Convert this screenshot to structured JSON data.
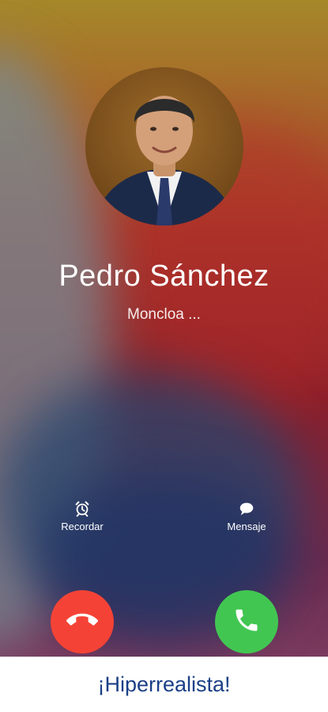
{
  "caller": {
    "name": "Pedro Sánchez",
    "subtitle": "Moncloa ..."
  },
  "actions": {
    "remind_label": "Recordar",
    "message_label": "Mensaje"
  },
  "buttons": {
    "decline_color": "#f44336",
    "accept_color": "#42c652"
  },
  "banner": {
    "text": "¡Hiperrealista!",
    "color": "#1a3f87"
  },
  "icons": [
    "alarm-clock-icon",
    "chat-bubble-icon",
    "phone-hangup-icon",
    "phone-icon"
  ]
}
